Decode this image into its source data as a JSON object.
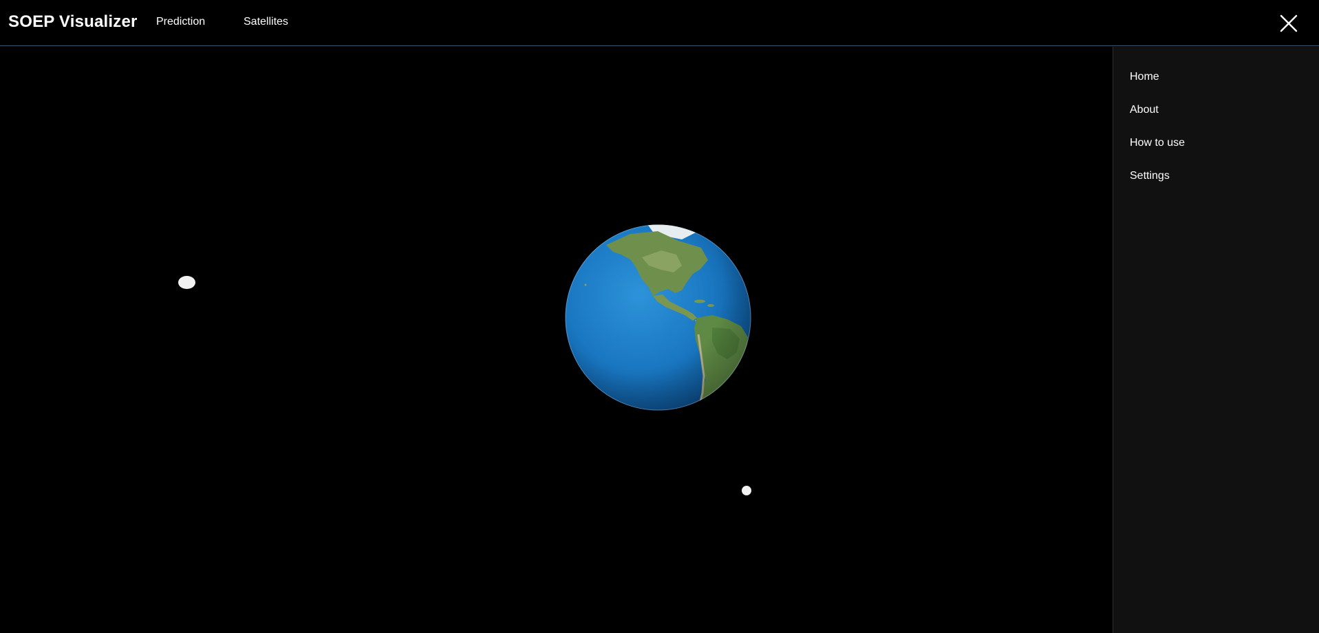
{
  "header": {
    "brand": "SOEP Visualizer",
    "nav": [
      "Prediction",
      "Satellites"
    ],
    "close_icon": "close-icon"
  },
  "sidebar": {
    "items": [
      {
        "label": "Home"
      },
      {
        "label": "About"
      },
      {
        "label": "How to use"
      },
      {
        "label": "Settings"
      }
    ]
  },
  "scene": {
    "background": "#000000",
    "globe_icon": "earth-globe",
    "satellite_count_visible": 2,
    "satellite_color": "#f2f2f2"
  },
  "colors": {
    "topbar_border": "#3f5566",
    "sidebar_background": "#111111",
    "ocean": "#1a78c2",
    "land": "#6b8a4a"
  }
}
